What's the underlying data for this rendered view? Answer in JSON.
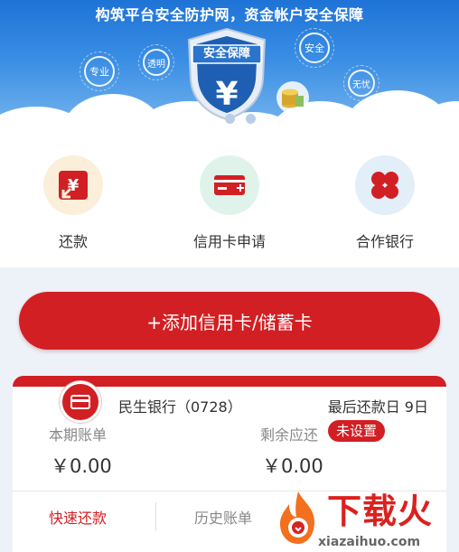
{
  "banner": {
    "slogan": "构筑平台安全防护网，资金帐户安全保障",
    "shield_title": "安全保障",
    "shield_symbol": "¥",
    "badges": [
      "专业",
      "透明",
      "安全",
      "无忧"
    ],
    "carousel": {
      "total": 3,
      "active": 1
    }
  },
  "quick_actions": [
    {
      "label": "还款",
      "icon": "repay-yen-icon",
      "color": "#fbefd9"
    },
    {
      "label": "信用卡申请",
      "icon": "credit-card-add-icon",
      "color": "#dff3ea"
    },
    {
      "label": "合作银行",
      "icon": "partner-bank-icon",
      "color": "#e2eef8"
    }
  ],
  "add_card": {
    "label": "+添加信用卡/储蓄卡"
  },
  "card": {
    "bank_name": "民生银行（0728）",
    "due_date": "最后还款日 9日",
    "current_bill_label": "本期账单",
    "current_bill_amount": "￥0.00",
    "remaining_label": "剩余应还",
    "remaining_tag": "未设置",
    "remaining_amount": "￥0.00",
    "action_fast_repay": "快速还款",
    "action_history": "历史账单"
  },
  "watermark": {
    "title": "下载火",
    "url": "xiazaihuo.com"
  },
  "colors": {
    "brand_red": "#d21f24",
    "banner_blue": "#2a7fdc",
    "page_bg": "#edf2f8"
  }
}
